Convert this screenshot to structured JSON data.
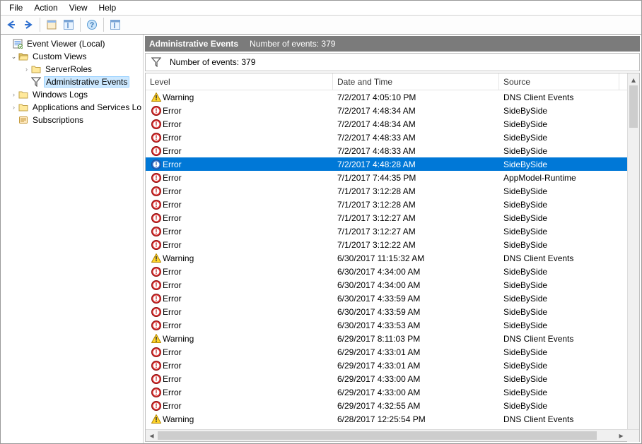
{
  "menu": {
    "items": [
      "File",
      "Action",
      "View",
      "Help"
    ]
  },
  "tree": {
    "root": "Event Viewer (Local)",
    "custom_views": "Custom Views",
    "server_roles": "ServerRoles",
    "admin_events": "Administrative Events",
    "windows_logs": "Windows Logs",
    "apps_services": "Applications and Services Lo",
    "subscriptions": "Subscriptions"
  },
  "header": {
    "title": "Administrative Events",
    "count_label": "Number of events: 379"
  },
  "filter": {
    "count_label": "Number of events: 379"
  },
  "columns": {
    "level": "Level",
    "date": "Date and Time",
    "source": "Source"
  },
  "events": [
    {
      "level": "Warning",
      "date": "7/2/2017 4:05:10 PM",
      "source": "DNS Client Events",
      "selected": false
    },
    {
      "level": "Error",
      "date": "7/2/2017 4:48:34 AM",
      "source": "SideBySide",
      "selected": false
    },
    {
      "level": "Error",
      "date": "7/2/2017 4:48:34 AM",
      "source": "SideBySide",
      "selected": false
    },
    {
      "level": "Error",
      "date": "7/2/2017 4:48:33 AM",
      "source": "SideBySide",
      "selected": false
    },
    {
      "level": "Error",
      "date": "7/2/2017 4:48:33 AM",
      "source": "SideBySide",
      "selected": false
    },
    {
      "level": "Error",
      "date": "7/2/2017 4:48:28 AM",
      "source": "SideBySide",
      "selected": true
    },
    {
      "level": "Error",
      "date": "7/1/2017 7:44:35 PM",
      "source": "AppModel-Runtime",
      "selected": false
    },
    {
      "level": "Error",
      "date": "7/1/2017 3:12:28 AM",
      "source": "SideBySide",
      "selected": false
    },
    {
      "level": "Error",
      "date": "7/1/2017 3:12:28 AM",
      "source": "SideBySide",
      "selected": false
    },
    {
      "level": "Error",
      "date": "7/1/2017 3:12:27 AM",
      "source": "SideBySide",
      "selected": false
    },
    {
      "level": "Error",
      "date": "7/1/2017 3:12:27 AM",
      "source": "SideBySide",
      "selected": false
    },
    {
      "level": "Error",
      "date": "7/1/2017 3:12:22 AM",
      "source": "SideBySide",
      "selected": false
    },
    {
      "level": "Warning",
      "date": "6/30/2017 11:15:32 AM",
      "source": "DNS Client Events",
      "selected": false
    },
    {
      "level": "Error",
      "date": "6/30/2017 4:34:00 AM",
      "source": "SideBySide",
      "selected": false
    },
    {
      "level": "Error",
      "date": "6/30/2017 4:34:00 AM",
      "source": "SideBySide",
      "selected": false
    },
    {
      "level": "Error",
      "date": "6/30/2017 4:33:59 AM",
      "source": "SideBySide",
      "selected": false
    },
    {
      "level": "Error",
      "date": "6/30/2017 4:33:59 AM",
      "source": "SideBySide",
      "selected": false
    },
    {
      "level": "Error",
      "date": "6/30/2017 4:33:53 AM",
      "source": "SideBySide",
      "selected": false
    },
    {
      "level": "Warning",
      "date": "6/29/2017 8:11:03 PM",
      "source": "DNS Client Events",
      "selected": false
    },
    {
      "level": "Error",
      "date": "6/29/2017 4:33:01 AM",
      "source": "SideBySide",
      "selected": false
    },
    {
      "level": "Error",
      "date": "6/29/2017 4:33:01 AM",
      "source": "SideBySide",
      "selected": false
    },
    {
      "level": "Error",
      "date": "6/29/2017 4:33:00 AM",
      "source": "SideBySide",
      "selected": false
    },
    {
      "level": "Error",
      "date": "6/29/2017 4:33:00 AM",
      "source": "SideBySide",
      "selected": false
    },
    {
      "level": "Error",
      "date": "6/29/2017 4:32:55 AM",
      "source": "SideBySide",
      "selected": false
    },
    {
      "level": "Warning",
      "date": "6/28/2017 12:25:54 PM",
      "source": "DNS Client Events",
      "selected": false
    }
  ]
}
